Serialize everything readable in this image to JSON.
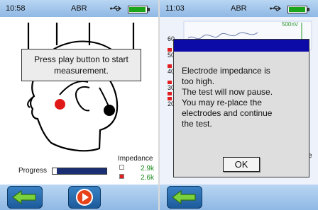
{
  "left_screen": {
    "status": {
      "time": "10:58",
      "title": "ABR"
    },
    "message": "Press play button to start measurement.",
    "progress": {
      "label": "Progress",
      "value": 0.08
    },
    "impedance": {
      "title": "Impedance",
      "rows": [
        {
          "value": "2.9k",
          "swatch_color": "#ffffff"
        },
        {
          "value": "2.6k",
          "swatch_color": "#e02020"
        }
      ]
    },
    "buttons": {
      "back": "back-arrow-icon",
      "play": "play-icon"
    },
    "electrode_colors": {
      "red": "#e01818",
      "black": "#000000"
    }
  },
  "right_screen": {
    "status": {
      "time": "11:03",
      "title": "ABR"
    },
    "graph": {
      "scale_label": "500nV",
      "y_ticks": [
        "60",
        "50",
        "40",
        "30",
        "20"
      ],
      "side_text": "e"
    },
    "dialog": {
      "lines": [
        "Electrode impedance is",
        "too high.",
        "The test will now pause.",
        "You may re-place the",
        "electrodes and continue",
        "the test."
      ],
      "ok_label": "OK"
    },
    "buttons": {
      "back": "back-arrow-icon"
    }
  },
  "colors": {
    "accent_blue": "#1c5a9a",
    "dialog_header": "#0d0ba8",
    "impedance_text": "#1a8a1a"
  }
}
